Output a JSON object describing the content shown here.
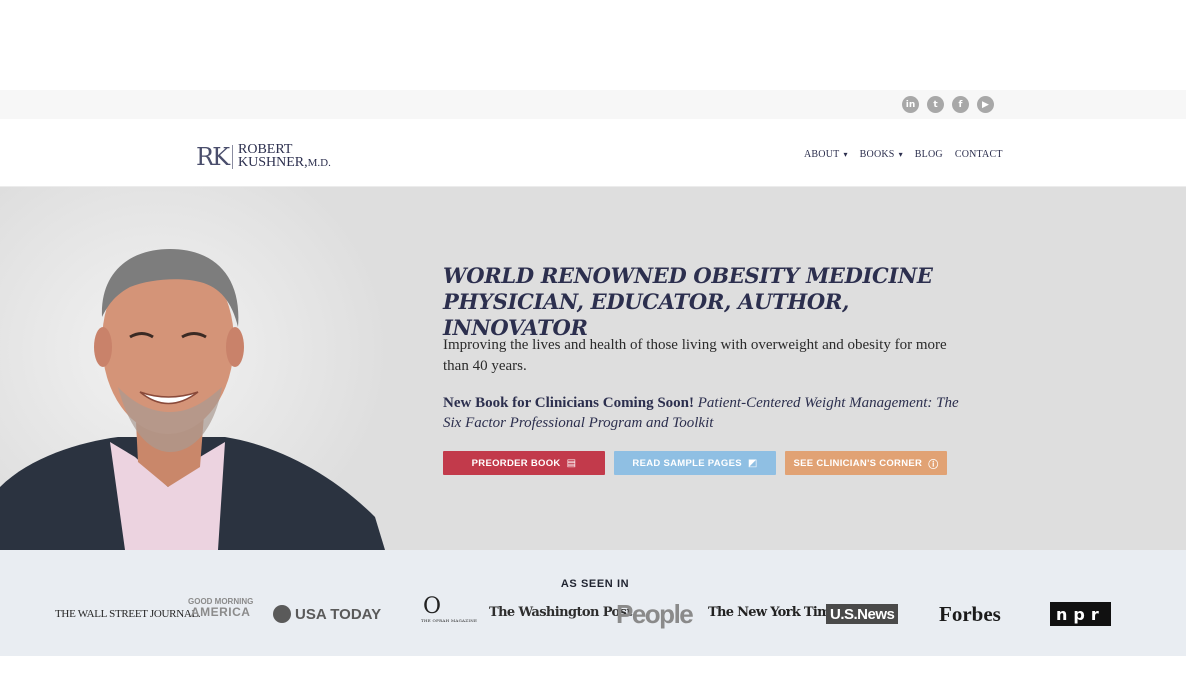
{
  "social": {
    "icons": [
      {
        "name": "linkedin-icon",
        "glyph": "in"
      },
      {
        "name": "twitter-icon",
        "glyph": "t"
      },
      {
        "name": "facebook-icon",
        "glyph": "f"
      },
      {
        "name": "youtube-icon",
        "glyph": "▶"
      }
    ],
    "icon_color": "#a8a8a8"
  },
  "header": {
    "logo_mark": "RK",
    "logo_line1": "ROBERT",
    "logo_line2": "KUSHNER,",
    "logo_suffix": "M.D.",
    "nav": [
      {
        "label": "ABOUT",
        "dropdown": true
      },
      {
        "label": "BOOKS",
        "dropdown": true
      },
      {
        "label": "BLOG",
        "dropdown": false
      },
      {
        "label": "CONTACT",
        "dropdown": false
      }
    ]
  },
  "hero": {
    "title_line1": "WORLD RENOWNED OBESITY MEDICINE",
    "title_line2": "PHYSICIAN, EDUCATOR, AUTHOR, INNOVATOR",
    "description": "Improving the lives and health of those living with overweight and obesity for more than 40 years.",
    "new_book_prefix": "New Book for Clinicians Coming Soon!",
    "new_book_title": "Patient-Centered Weight Management: The Six Factor Professional Program and Toolkit",
    "buttons": {
      "preorder": {
        "label": "PREORDER BOOK",
        "icon": "book-icon",
        "color": "#c23a4b"
      },
      "sample": {
        "label": "READ SAMPLE PAGES",
        "icon": "open-book-icon",
        "color": "#8fbfe3"
      },
      "clinician": {
        "label": "SEE CLINICIAN'S CORNER",
        "icon": "info-icon",
        "color": "#e1a274"
      }
    },
    "background": "#dedede",
    "accent": "#2c2f4e"
  },
  "press": {
    "title": "AS SEEN IN",
    "logos": {
      "wsj": "THE WALL STREET JOURNAL.",
      "gma_top": "GOOD MORNING",
      "gma_bottom": "AMERICA",
      "usatoday": "USA TODAY",
      "oprah_o": "O",
      "oprah_sub": "THE OPRAH MAGAZINE",
      "wapo": "The Washington Post",
      "people": "People",
      "nyt": "The New York Times",
      "usnews": "U.S.News",
      "forbes": "Forbes",
      "npr": "npr"
    },
    "background": "#e9edf2"
  }
}
